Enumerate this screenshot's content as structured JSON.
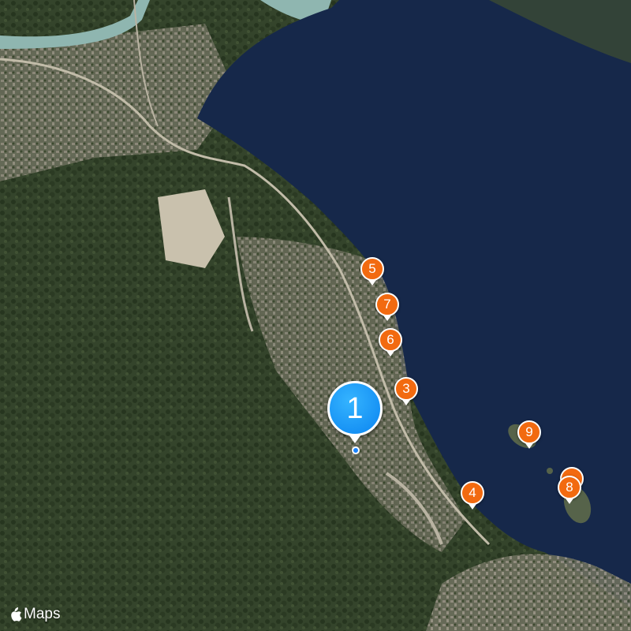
{
  "map": {
    "view": "satellite",
    "colors": {
      "water": "#16284a",
      "land": "#3a4a30",
      "urban": "#8a8577",
      "pin": "#f26a10",
      "primary_pin": "#0a84f0"
    }
  },
  "markers": [
    {
      "label": "1",
      "primary": true
    },
    {
      "label": "3"
    },
    {
      "label": "4"
    },
    {
      "label": "5"
    },
    {
      "label": "6"
    },
    {
      "label": "7"
    },
    {
      "label": "8"
    },
    {
      "label": "9"
    }
  ],
  "attribution": {
    "logo": "apple-logo-icon",
    "text": "Maps"
  }
}
